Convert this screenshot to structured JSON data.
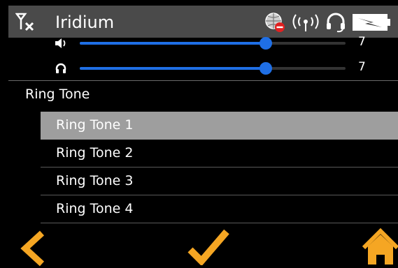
{
  "header": {
    "title": "Iridium",
    "status_icons": [
      "no-signal-icon",
      "globe-disabled-icon",
      "radio-broadcast-icon",
      "headset-icon",
      "battery-charging-icon"
    ]
  },
  "sliders": {
    "volume": {
      "icon": "speaker-icon",
      "value": "7",
      "level": 0.7
    },
    "ringer": {
      "icon": "ringer-icon",
      "value": "7",
      "level": 0.7
    }
  },
  "section": {
    "label": "Ring Tone"
  },
  "ring_tones": [
    {
      "label": "Ring Tone 1",
      "selected": true
    },
    {
      "label": "Ring Tone 2",
      "selected": false
    },
    {
      "label": "Ring Tone 3",
      "selected": false
    },
    {
      "label": "Ring Tone 4",
      "selected": false
    }
  ],
  "footer": {
    "back_icon": "chevron-left-icon",
    "ok_icon": "checkmark-icon",
    "home_icon": "home-icon"
  },
  "colors": {
    "accent_orange": "#f5a623",
    "slider_blue": "#1f6fe5",
    "header_gray": "#4a4a4a",
    "selected_gray": "#9e9e9e",
    "alert_red": "#e02020"
  }
}
